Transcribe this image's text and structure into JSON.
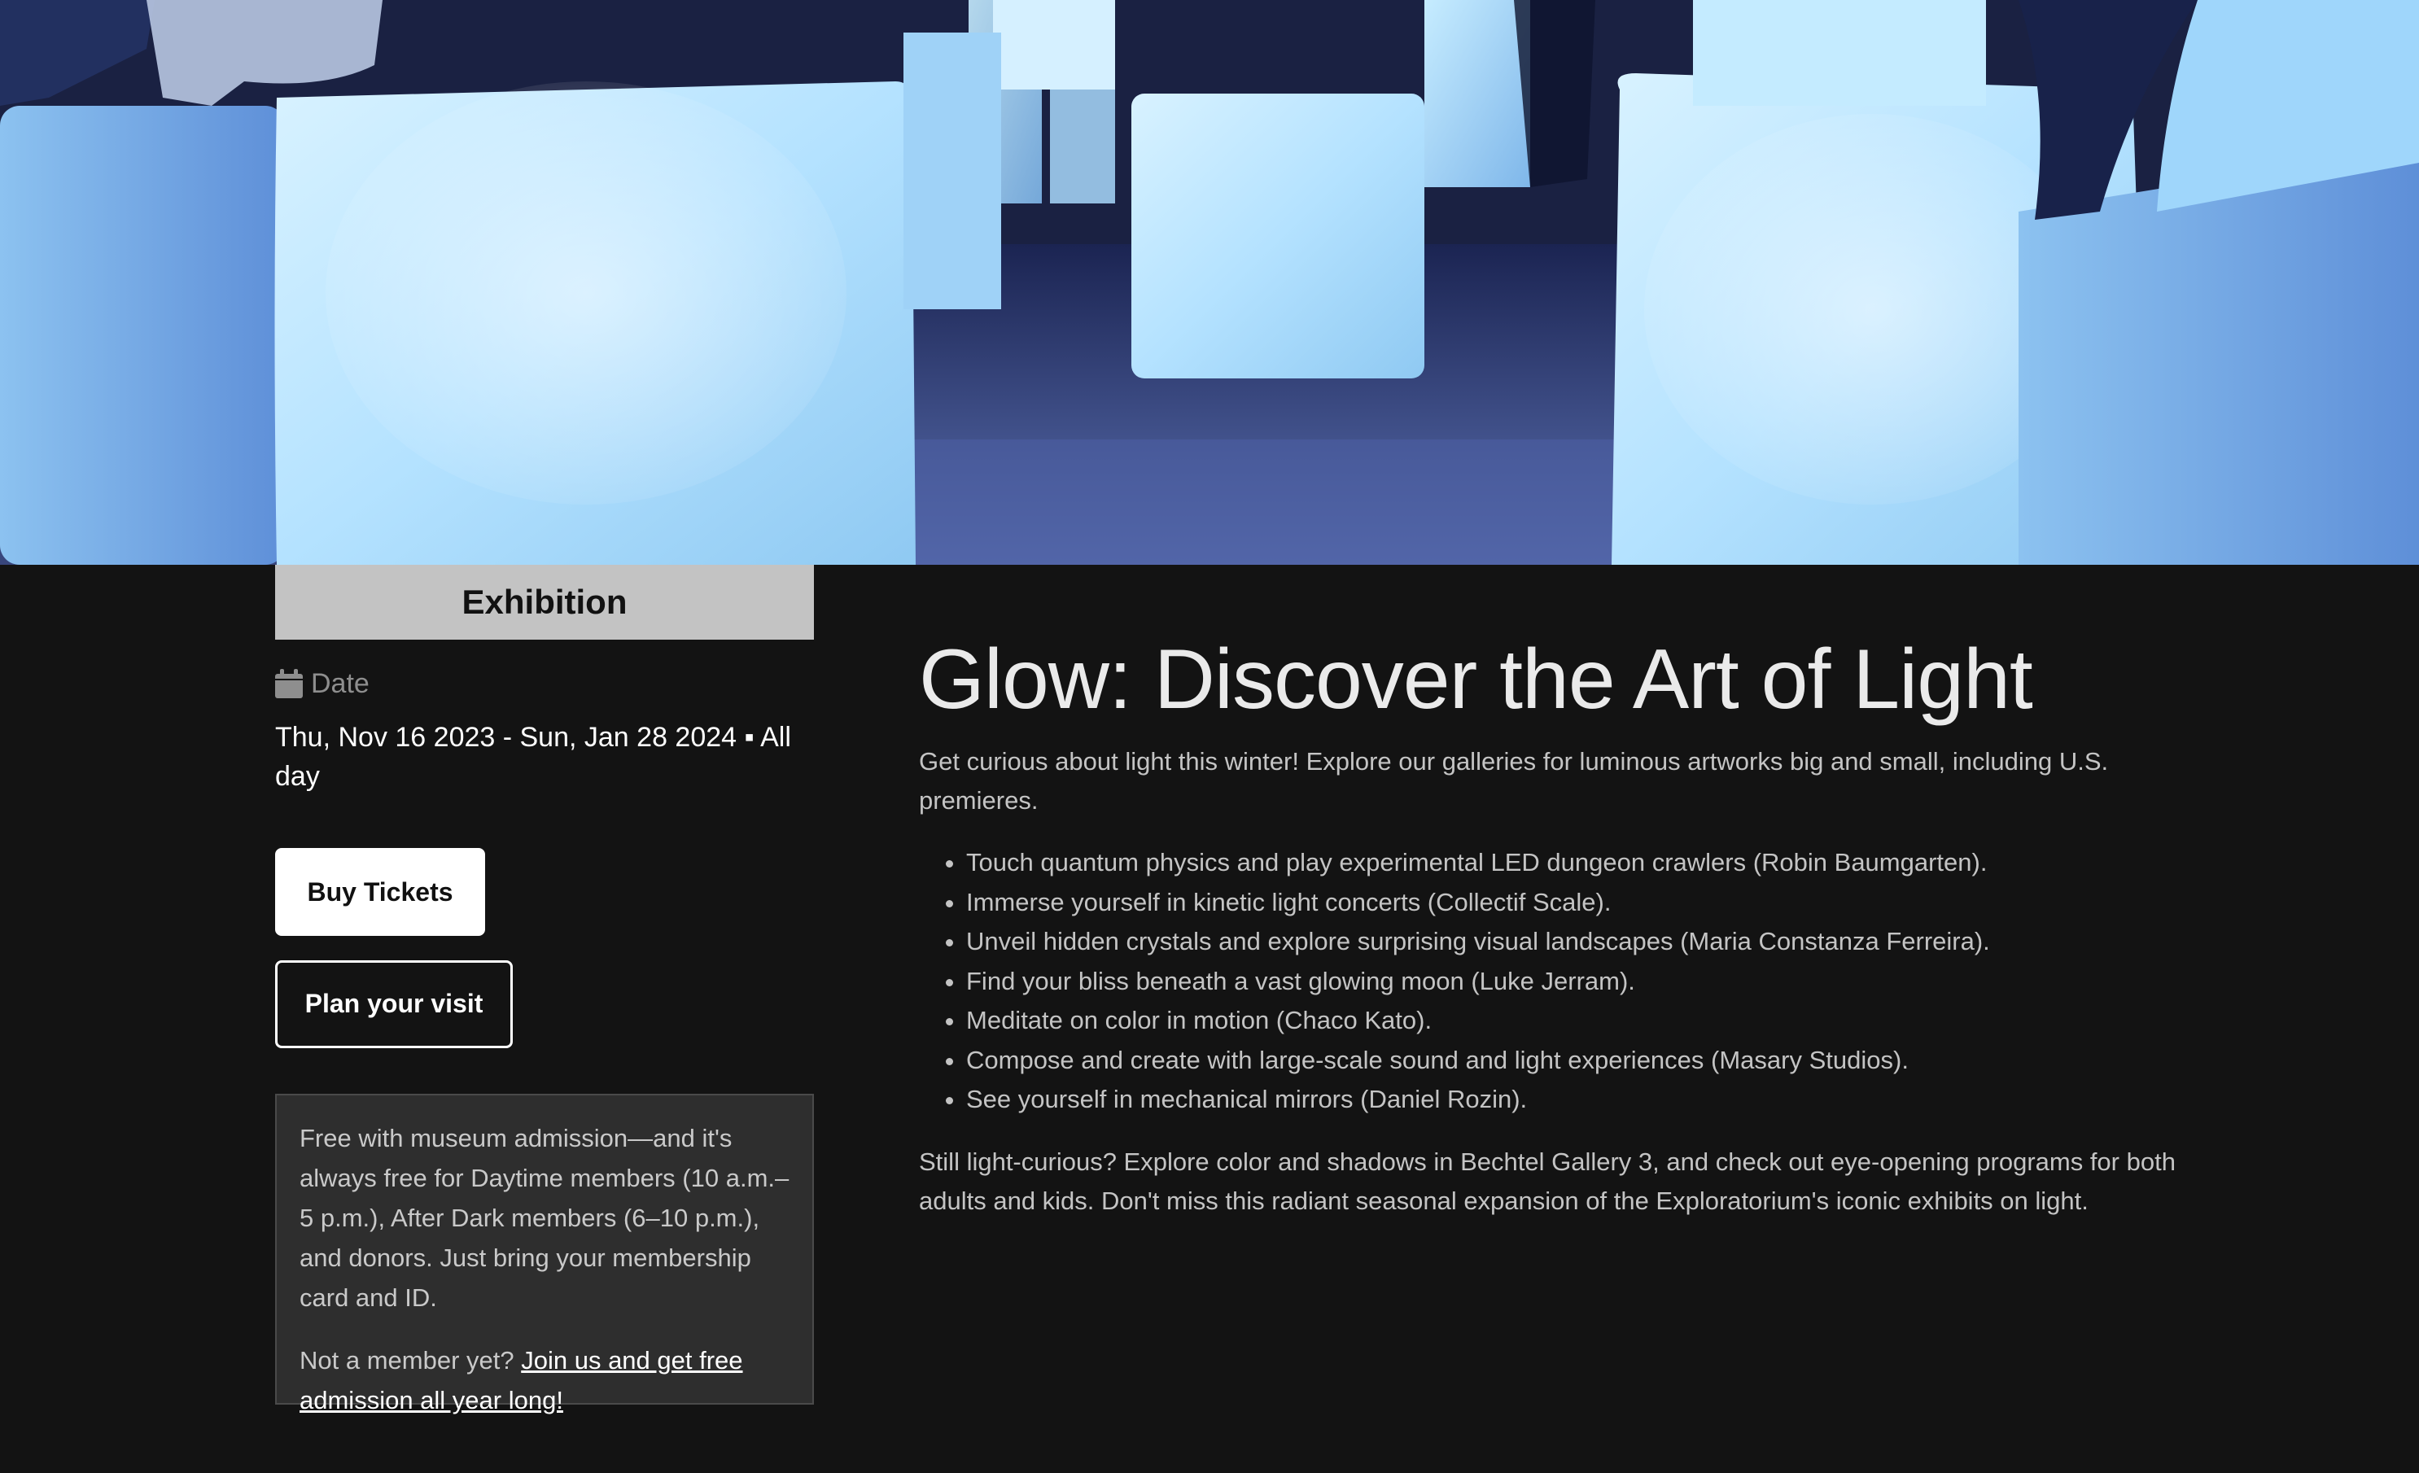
{
  "hero": {
    "image": "glowing-light-cubes-photo"
  },
  "sidebar": {
    "tag": "Exhibition",
    "date_label": "Date",
    "date_value": "Thu, Nov 16 2023 - Sun, Jan 28 2024 ▪ All day",
    "buy_tickets": "Buy Tickets",
    "plan_visit": "Plan your visit",
    "admission_text": "Free with museum admission—and it's always free for Daytime members (10 a.m.–5 p.m.), After Dark members (6–10 p.m.), and donors. Just bring your membership card and ID.",
    "member_prompt": "Not a member yet?",
    "member_link": "Join us and get free admission all year long!"
  },
  "main": {
    "title": "Glow: Discover the Art of Light",
    "intro": "Get curious about light this winter! Explore our galleries for luminous artworks big and small, including U.S. premieres.",
    "bullets": [
      "Touch quantum physics and play experimental LED dungeon crawlers (Robin Baumgarten).",
      "Immerse yourself in kinetic light concerts (Collectif Scale).",
      "Unveil hidden crystals and explore surprising visual landscapes (Maria Constanza Ferreira).",
      "Find your bliss beneath a vast glowing moon (Luke Jerram).",
      "Meditate on color in motion (Chaco Kato).",
      "Compose and create with large-scale sound and light experiences (Masary Studios).",
      "See yourself in mechanical mirrors (Daniel Rozin)."
    ],
    "outro": "Still light-curious? Explore color and shadows in Bechtel Gallery 3, and check out eye-opening programs for both adults and kids. Don't miss this radiant seasonal expansion of the Exploratorium's iconic exhibits on light."
  },
  "colors": {
    "background": "#131313",
    "tag_background": "#c3c3c3",
    "info_box_background": "#2e2e2e",
    "cube_glow": "#b9e4ff"
  }
}
